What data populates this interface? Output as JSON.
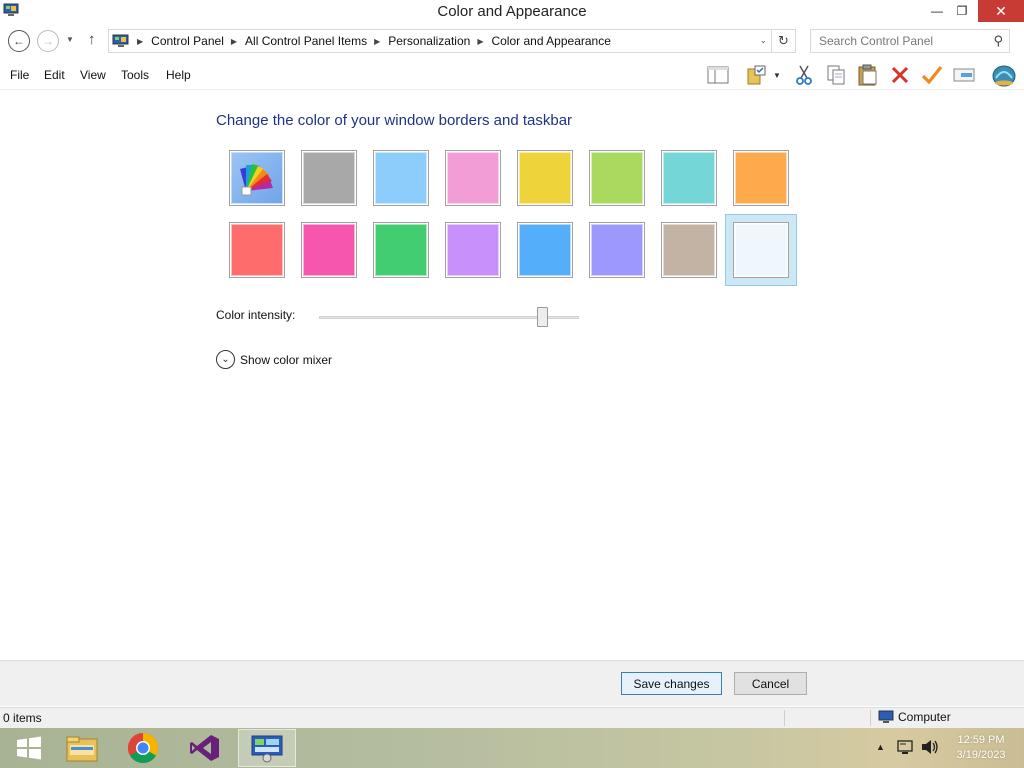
{
  "window": {
    "title": "Color and Appearance",
    "minimize_glyph": "—",
    "restore_glyph": "❐",
    "close_glyph": "✕"
  },
  "address": {
    "breadcrumbs": [
      "Control Panel",
      "All Control Panel Items",
      "Personalization",
      "Color and Appearance"
    ],
    "search_placeholder": "Search Control Panel"
  },
  "menu": {
    "items": [
      "File",
      "Edit",
      "View",
      "Tools",
      "Help"
    ]
  },
  "toolbar_icons": [
    "layout-pane-icon",
    "folder-properties-icon",
    "cut-icon",
    "copy-icon",
    "paste-icon",
    "delete-icon",
    "check-icon",
    "rename-icon",
    "shell-icon"
  ],
  "content": {
    "heading": "Change the color of your window borders and taskbar",
    "swatches": [
      {
        "name": "automatic",
        "color": "#8ab8f0"
      },
      {
        "name": "gray",
        "color": "#a8a8a8"
      },
      {
        "name": "sky-blue",
        "color": "#8ccdfb"
      },
      {
        "name": "pink",
        "color": "#f39dd7"
      },
      {
        "name": "yellow",
        "color": "#efd33a"
      },
      {
        "name": "lime",
        "color": "#aad95f"
      },
      {
        "name": "teal",
        "color": "#74d6d6"
      },
      {
        "name": "orange",
        "color": "#fdaa4d"
      },
      {
        "name": "red",
        "color": "#fe6c6c"
      },
      {
        "name": "magenta",
        "color": "#f656ad"
      },
      {
        "name": "green",
        "color": "#43cd71"
      },
      {
        "name": "violet",
        "color": "#c790fb"
      },
      {
        "name": "blue",
        "color": "#55aef9"
      },
      {
        "name": "periwinkle",
        "color": "#9d98fb"
      },
      {
        "name": "taupe",
        "color": "#c3b3a5"
      },
      {
        "name": "frost",
        "color": "#eff7fd"
      }
    ],
    "selected_swatch": "frost",
    "intensity_label": "Color intensity:",
    "intensity_value": 0.86,
    "mixer_label": "Show color mixer"
  },
  "buttons": {
    "save": "Save changes",
    "cancel": "Cancel"
  },
  "status": {
    "items": "0 items",
    "location": "Computer"
  },
  "taskbar": {
    "apps": [
      "start-icon",
      "file-explorer-icon",
      "chrome-icon",
      "visual-studio-icon",
      "control-panel-icon"
    ],
    "time": "12:59 PM",
    "date": "3/19/2023"
  }
}
